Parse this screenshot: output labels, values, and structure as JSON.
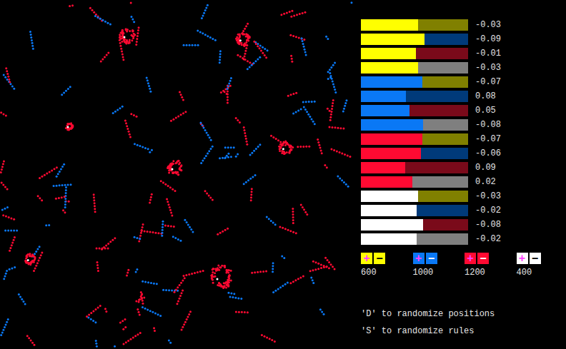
{
  "species": [
    {
      "name": "yellow",
      "color": "#ffff00",
      "count": "600",
      "plus": "+",
      "minus": "−"
    },
    {
      "name": "blue",
      "color": "#0a78f5",
      "count": "1000",
      "plus": "+",
      "minus": "−"
    },
    {
      "name": "red",
      "color": "#ff0a32",
      "count": "1200",
      "plus": "+",
      "minus": "−"
    },
    {
      "name": "white",
      "color": "#ffffff",
      "count": "400",
      "plus": "+",
      "minus": "−"
    }
  ],
  "rules": [
    {
      "color": "#ffff00",
      "targetColor": "#808000",
      "level": 0.53,
      "value": "-0.03"
    },
    {
      "color": "#ffff00",
      "targetColor": "#003a7a",
      "level": 0.59,
      "value": "-0.09"
    },
    {
      "color": "#ffff00",
      "targetColor": "#7a0a1a",
      "level": 0.51,
      "value": "-0.01"
    },
    {
      "color": "#ffff00",
      "targetColor": "#7f7f7f",
      "level": 0.53,
      "value": "-0.03"
    },
    {
      "color": "#0a78f5",
      "targetColor": "#808000",
      "level": 0.57,
      "value": "-0.07"
    },
    {
      "color": "#0a78f5",
      "targetColor": "#003a7a",
      "level": 0.42,
      "value": "0.08"
    },
    {
      "color": "#0a78f5",
      "targetColor": "#7a0a1a",
      "level": 0.45,
      "value": "0.05"
    },
    {
      "color": "#0a78f5",
      "targetColor": "#7f7f7f",
      "level": 0.58,
      "value": "-0.08"
    },
    {
      "color": "#ff0a32",
      "targetColor": "#808000",
      "level": 0.57,
      "value": "-0.07"
    },
    {
      "color": "#ff0a32",
      "targetColor": "#003a7a",
      "level": 0.56,
      "value": "-0.06"
    },
    {
      "color": "#ff0a32",
      "targetColor": "#7a0a1a",
      "level": 0.41,
      "value": "0.09"
    },
    {
      "color": "#ff0a32",
      "targetColor": "#7f7f7f",
      "level": 0.48,
      "value": "0.02"
    },
    {
      "color": "#ffffff",
      "targetColor": "#808000",
      "level": 0.53,
      "value": "-0.03"
    },
    {
      "color": "#ffffff",
      "targetColor": "#003a7a",
      "level": 0.52,
      "value": "-0.02"
    },
    {
      "color": "#ffffff",
      "targetColor": "#7a0a1a",
      "level": 0.58,
      "value": "-0.08"
    },
    {
      "color": "#ffffff",
      "targetColor": "#7f7f7f",
      "level": 0.52,
      "value": "-0.02"
    }
  ],
  "hints": [
    "'D' to randomize positions",
    "'S' to randomize rules"
  ]
}
